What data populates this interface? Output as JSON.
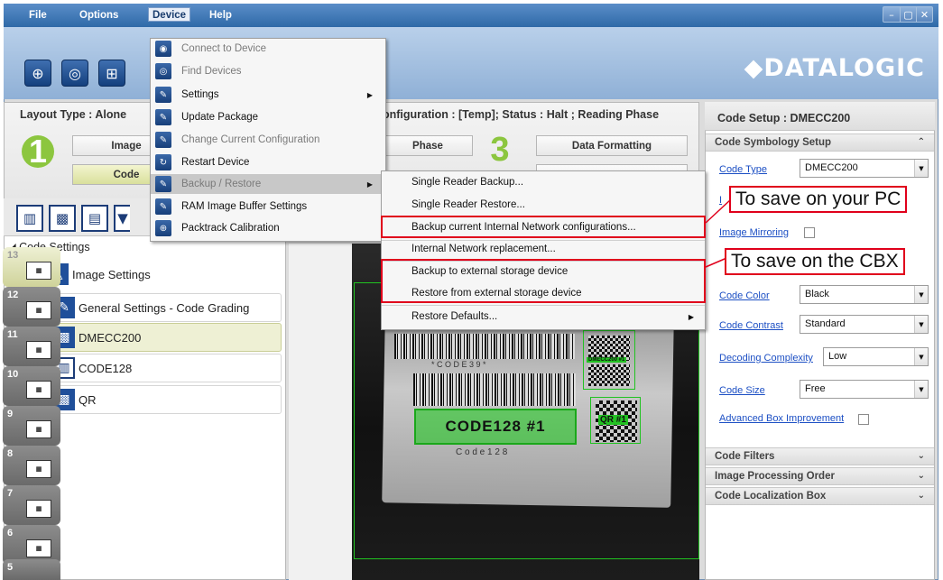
{
  "menubar": {
    "items": [
      "File",
      "Options",
      "Device",
      "Help"
    ],
    "window_controls": [
      "–",
      "▢",
      "✕"
    ]
  },
  "toolbar": {
    "logo": "◆DATALOGIC",
    "buttons": [
      "connect-icon",
      "find-devices-icon",
      "network-icon"
    ]
  },
  "layout_bar": {
    "layout_type": "Layout Type : Alone",
    "config_status": "onfiguration : [Temp]; Status : Halt ; Reading Phase",
    "steps": [
      {
        "number": "1",
        "buttons": [
          "Image",
          "Code"
        ]
      },
      {
        "number": "3",
        "buttons": [
          "Phase",
          "Data Formatting"
        ]
      }
    ]
  },
  "device_menu": {
    "items": [
      {
        "label": "Connect to Device",
        "icon": "connect-icon",
        "enabled": false
      },
      {
        "label": "Find Devices",
        "icon": "find-devices-icon",
        "enabled": false
      },
      {
        "label": "Settings",
        "icon": "wrench-icon",
        "enabled": true,
        "submenu": true
      },
      {
        "label": "Update Package",
        "icon": "wrench-icon",
        "enabled": true
      },
      {
        "label": "Change Current Configuration",
        "icon": "wrench-icon",
        "enabled": false
      },
      {
        "label": "Restart Device",
        "icon": "restart-icon",
        "enabled": true
      },
      {
        "label": "Backup / Restore",
        "icon": "wrench-icon",
        "enabled": false,
        "submenu": true,
        "highlighted": true
      },
      {
        "label": "RAM Image Buffer Settings",
        "icon": "wrench-icon",
        "enabled": true
      },
      {
        "label": "Packtrack Calibration",
        "icon": "crosshair-icon",
        "enabled": true
      }
    ]
  },
  "backup_submenu": {
    "items": [
      {
        "label": "Single Reader Backup..."
      },
      {
        "label": "Single Reader Restore..."
      },
      {
        "label": "Backup current Internal Network configurations...",
        "boxed": true
      },
      {
        "label": "Internal Network replacement..."
      },
      {
        "label": "Backup to external storage device",
        "boxed": true
      },
      {
        "label": "Restore from external storage device",
        "boxed": true
      },
      {
        "label": "Restore Defaults...",
        "submenu": true
      }
    ]
  },
  "callouts": {
    "pc": "To save on your PC",
    "cbx": "To save on the CBX"
  },
  "tree": {
    "root": "Code Settings",
    "items": [
      {
        "label": "Image Settings",
        "icon": "image-icon"
      },
      {
        "label": "General Settings - Code Grading",
        "icon": "wrench-icon"
      },
      {
        "label": "DMECC200",
        "icon": "datamatrix-icon",
        "selected": true
      },
      {
        "label": "CODE128",
        "icon": "barcode-icon"
      },
      {
        "label": "QR",
        "icon": "qr-icon"
      }
    ]
  },
  "filmstrip": {
    "frames": [
      "13",
      "12",
      "11",
      "10",
      "9",
      "8",
      "7",
      "6",
      "5"
    ]
  },
  "image_view": {
    "code39_text": "* C O D E   3 9 *",
    "code128_label": "CODE128  #1",
    "code128_text": "C o d e   1 2 8",
    "dmecc_tag": "DMECC200 #1",
    "qr_tag": "QR #1"
  },
  "right_panel": {
    "title": "Code Setup : DMECC200",
    "section_symbology": "Code Symbology Setup",
    "fields": {
      "code_type": {
        "label": "Code Type",
        "value": "DMECC200"
      },
      "image_mirroring": {
        "label": "Image Mirroring",
        "checked": false
      },
      "code_color": {
        "label": "Code Color",
        "value": "Black"
      },
      "code_contrast": {
        "label": "Code Contrast",
        "value": "Standard"
      },
      "decoding_complexity": {
        "label": "Decoding Complexity",
        "value": "Low"
      },
      "code_size": {
        "label": "Code Size",
        "value": "Free"
      },
      "advanced_box": {
        "label": "Advanced Box Improvement",
        "checked": false
      }
    },
    "collapsed_sections": [
      "Code Filters",
      "Image Processing Order",
      "Code Localization Box"
    ]
  },
  "colors": {
    "accent_green": "#8cc63f",
    "callout_red": "#e0001b",
    "menubar_blue": "#2f6aa8"
  }
}
